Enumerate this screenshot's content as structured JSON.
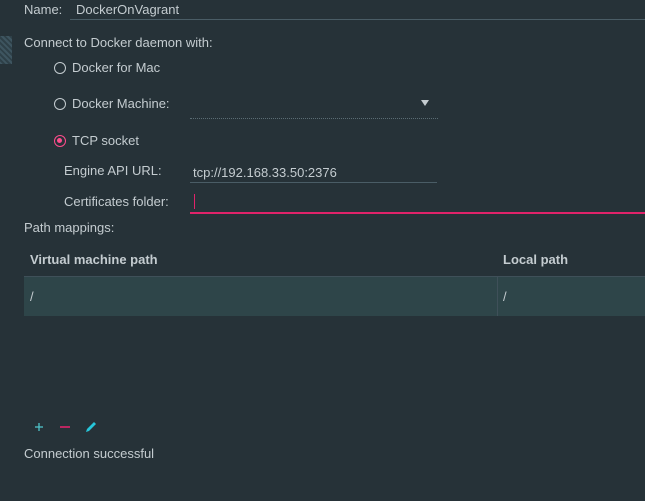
{
  "form": {
    "name_label": "Name:",
    "name_value": "DockerOnVagrant",
    "connect_label": "Connect to Docker daemon with:",
    "options": [
      {
        "label": "Docker for Mac",
        "selected": false
      },
      {
        "label": "Docker Machine:",
        "selected": false
      },
      {
        "label": "TCP socket",
        "selected": true
      }
    ],
    "machine_dropdown_value": "",
    "engine_api_label": "Engine API URL:",
    "engine_api_value": "tcp://192.168.33.50:2376",
    "certificates_label": "Certificates folder:",
    "certificates_value": ""
  },
  "path_mappings": {
    "label": "Path mappings:",
    "columns": [
      "Virtual machine path",
      "Local path"
    ],
    "rows": [
      {
        "vm_path": "/",
        "local_path": "/"
      }
    ]
  },
  "toolbar": {
    "icons": [
      "add-icon",
      "remove-icon",
      "edit-icon"
    ]
  },
  "status": {
    "text": "Connection successful"
  },
  "colors": {
    "background": "#263238",
    "accent": "#ff4d8d",
    "row_background": "#2e4549",
    "add_icon": "#4fc3c9",
    "remove_icon": "#e0236a",
    "edit_icon": "#26c6da"
  }
}
